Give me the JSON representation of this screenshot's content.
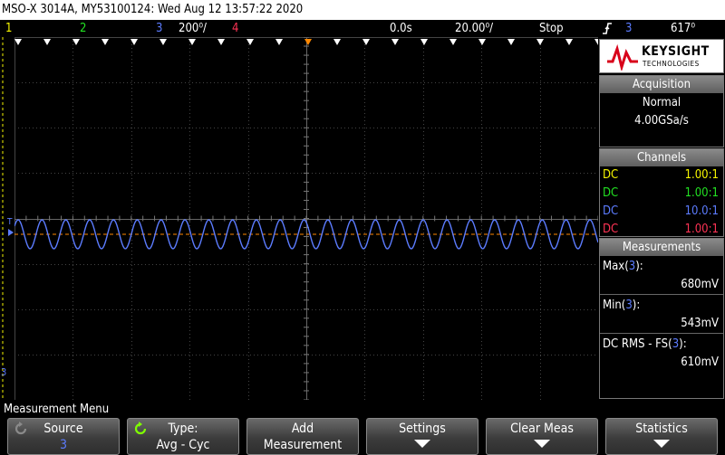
{
  "title": "MSO-X 3014A, MY53100124: Wed Aug 12 13:57:22 2020",
  "status": {
    "ch1": "1",
    "ch2": "2",
    "ch3": "3",
    "ch3_scale": "200",
    "ch3_scale_unit": "⁰/",
    "ch4": "4",
    "time_delay": "0.0s",
    "time_scale": "20.00⁰/",
    "run_state": "Stop",
    "trigger_icon": "trigger-rising-edge-icon",
    "trigger_source": "3",
    "trigger_level": "617⁰"
  },
  "scope": {
    "ground_marker": "3",
    "trigger_marker": "T"
  },
  "logo": {
    "brand": "KEYSIGHT",
    "sub": "TECHNOLOGIES"
  },
  "acquisition": {
    "header": "Acquisition",
    "mode": "Normal",
    "rate": "4.00GSa/s"
  },
  "channels": {
    "header": "Channels",
    "items": [
      {
        "coupling": "DC",
        "probe": "1.00:1",
        "color": "#f5f500"
      },
      {
        "coupling": "DC",
        "probe": "1.00:1",
        "color": "#22e022"
      },
      {
        "coupling": "DC",
        "probe": "10.0:1",
        "color": "#5c7cff"
      },
      {
        "coupling": "DC",
        "probe": "1.00:1",
        "color": "#ff3355"
      }
    ]
  },
  "measurements": {
    "header": "Measurements",
    "items": [
      {
        "label": "Max",
        "src": "3",
        "value": "680mV"
      },
      {
        "label": "Min",
        "src": "3",
        "value": "543mV"
      },
      {
        "label": "DC RMS - FS",
        "src": "3",
        "value": "610mV"
      }
    ]
  },
  "menu": {
    "title": "Measurement Menu",
    "softkeys": [
      {
        "line1": "Source",
        "line2": "3",
        "icon": "rotate-knob-icon"
      },
      {
        "line1": "Type:",
        "line2": "Avg - Cyc",
        "icon": "rotate-knob-icon"
      },
      {
        "line1": "Add",
        "line2": "Measurement"
      },
      {
        "line1": "Settings",
        "arrow": "down-arrow-icon"
      },
      {
        "line1": "Clear Meas",
        "arrow": "down-arrow-icon"
      },
      {
        "line1": "Statistics",
        "arrow": "down-arrow-icon"
      }
    ]
  },
  "colors": {
    "ch1": "#f5f500",
    "ch2": "#22e022",
    "ch3": "#5c7cff",
    "ch4": "#ff3355",
    "trigger_line": "#ff8800",
    "grid": "#444444"
  }
}
